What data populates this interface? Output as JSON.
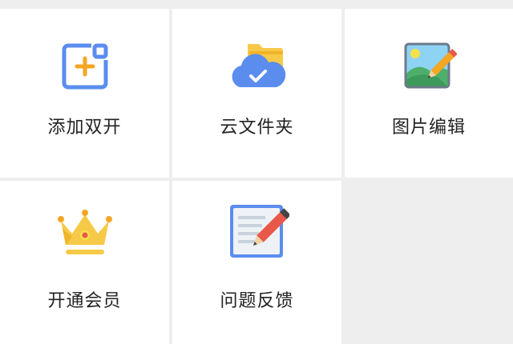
{
  "tiles": [
    {
      "id": "add-dual",
      "label": "添加双开",
      "icon": "add-square-icon"
    },
    {
      "id": "cloud-folder",
      "label": "云文件夹",
      "icon": "cloud-folder-icon"
    },
    {
      "id": "image-edit",
      "label": "图片编辑",
      "icon": "image-edit-icon"
    },
    {
      "id": "vip",
      "label": "开通会员",
      "icon": "crown-icon"
    },
    {
      "id": "feedback",
      "label": "问题反馈",
      "icon": "feedback-note-icon"
    }
  ],
  "colors": {
    "blue": "#5b8def",
    "orange": "#f5a623",
    "yellow": "#f7c948",
    "red": "#e8594a",
    "green": "#4caf6a",
    "sky": "#8fd3f4"
  }
}
